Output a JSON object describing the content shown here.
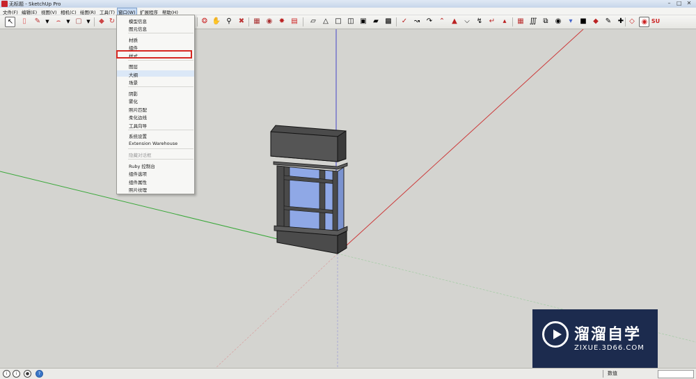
{
  "window": {
    "title": "无标题 - SketchUp Pro"
  },
  "menubar": {
    "items": [
      {
        "label": "文件(F)"
      },
      {
        "label": "编辑(E)"
      },
      {
        "label": "视图(V)"
      },
      {
        "label": "相机(C)"
      },
      {
        "label": "绘图(R)"
      },
      {
        "label": "工具(T)"
      },
      {
        "label": "窗口(W)"
      },
      {
        "label": "扩展程序"
      },
      {
        "label": "帮助(H)"
      }
    ],
    "active": "窗口(W)"
  },
  "window_menu": {
    "items": [
      {
        "label": "模型信息",
        "enabled": true
      },
      {
        "label": "图元信息",
        "enabled": true
      },
      {
        "label": "材质",
        "enabled": true
      },
      {
        "label": "组件",
        "enabled": true
      },
      {
        "label": "样式",
        "enabled": true,
        "highlighted": true
      },
      {
        "label": "图层",
        "enabled": true
      },
      {
        "label": "大纲",
        "enabled": true,
        "hover": true
      },
      {
        "label": "场景",
        "enabled": true
      },
      {
        "label": "阴影",
        "enabled": true
      },
      {
        "label": "雾化",
        "enabled": true
      },
      {
        "label": "照片匹配",
        "enabled": true
      },
      {
        "label": "柔化边线",
        "enabled": true
      },
      {
        "label": "工具向导",
        "enabled": true
      },
      {
        "label": "系统设置",
        "enabled": true
      },
      {
        "label": "Extension Warehouse",
        "enabled": true
      },
      {
        "label": "隐藏对话框",
        "enabled": false
      },
      {
        "label": "Ruby 控制台",
        "enabled": true
      },
      {
        "label": "组件选项",
        "enabled": true
      },
      {
        "label": "组件属性",
        "enabled": true
      },
      {
        "label": "照片纹理",
        "enabled": true
      }
    ]
  },
  "toolbar": {
    "tools": [
      "select-tool-icon",
      "eraser-tool-icon",
      "pencil-tool-icon",
      "arc-tool-icon",
      "rectangle-tool-icon",
      "push-pull-tool-icon",
      "rotate-tool-icon",
      "orbit-tool-icon",
      "pan-tool-icon",
      "zoom-tool-icon",
      "zoom-extents-icon",
      "warehouse-icon",
      "components-icon",
      "extension-icon",
      "share-icon",
      "iso-view-icon",
      "top-view-icon",
      "front-view-icon",
      "right-view-icon",
      "back-view-icon",
      "left-view-icon",
      "xray-icon",
      "wireframe-icon",
      "hidden-line-icon",
      "shaded-icon",
      "textured-icon",
      "monochrome-icon",
      "sandbox-icon",
      "section-plane-icon",
      "follow-me-icon",
      "offset-icon",
      "scale-icon",
      "flip-icon",
      "tape-measure-icon",
      "protractor-icon",
      "dimension-icon",
      "text-icon",
      "axes-icon",
      "3d-text-icon",
      "layers-icon",
      "paint-bucket-icon",
      "walk-icon",
      "look-around-icon",
      "position-camera-icon",
      "solid-tools-icon",
      "ruby-icon",
      "su-logo-icon"
    ]
  },
  "status": {
    "measurements_label": "数值",
    "measurements_value": ""
  },
  "watermark": {
    "main": "溜溜自学",
    "sub": "ZIXUE.3D66.COM"
  },
  "colors": {
    "viewport_bg": "#d4d4d0",
    "axis_red": "#cc3a3a",
    "axis_green": "#3aa83a",
    "axis_blue": "#4646c8",
    "glass": "#8fa8e6",
    "frame": "#4a4a4a",
    "highlight_border": "#d62822",
    "watermark_bg": "#1c2b4e"
  }
}
